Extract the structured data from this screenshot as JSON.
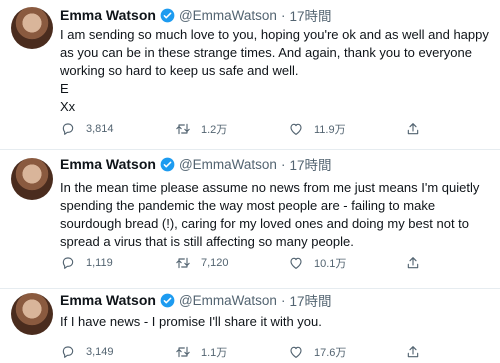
{
  "tweets": [
    {
      "author": "Emma Watson",
      "handle": "@EmmaWatson",
      "time": "17時間",
      "lines": [
        "I am sending so much love to you, hoping you're ok and as well and happy",
        "as you can be in these strange times. And again, thank you to everyone",
        "working so hard to keep us safe and well.",
        "E",
        "Xx"
      ],
      "replies": "3,814",
      "retweets": "1.2万",
      "likes": "11.9万"
    },
    {
      "author": "Emma Watson",
      "handle": "@EmmaWatson",
      "time": "17時間",
      "lines": [
        "In the mean time please assume no news from me just means I'm quietly",
        "spending the pandemic the way most people are - failing to make",
        "sourdough bread (!), caring for my loved ones and doing my best not to",
        "spread a virus that is still affecting so many people."
      ],
      "replies": "1,119",
      "retweets": "7,120",
      "likes": "10.1万"
    },
    {
      "author": "Emma Watson",
      "handle": "@EmmaWatson",
      "time": "17時間",
      "lines": [
        "If I have news - I promise I'll share it with you."
      ],
      "replies": "3,149",
      "retweets": "1.1万",
      "likes": "17.6万"
    }
  ],
  "icons": {
    "verified": "verified-badge-icon",
    "reply": "reply-icon",
    "retweet": "retweet-icon",
    "like": "like-icon",
    "share": "share-icon"
  },
  "colors": {
    "text": "#0f1419",
    "muted": "#536471",
    "verified": "#1d9bf0",
    "divider": "#e6ecf0"
  }
}
